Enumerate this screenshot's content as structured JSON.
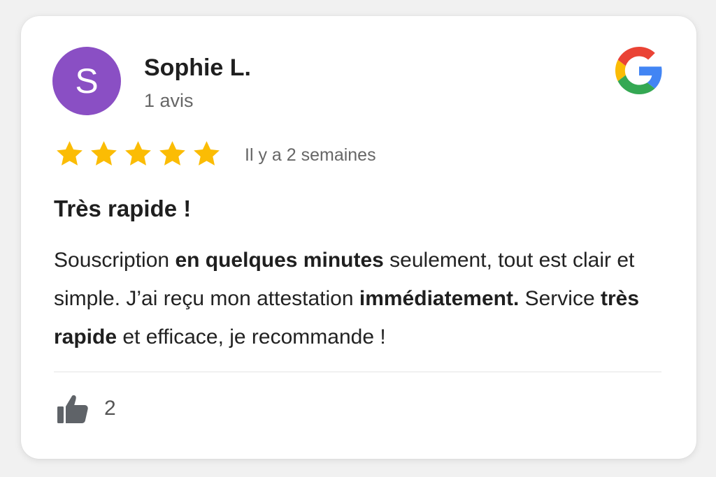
{
  "reviewer": {
    "initial": "S",
    "name": "Sophie L.",
    "review_count": "1 avis",
    "avatar_color": "#8a4fc4"
  },
  "brand": {
    "icon": "google-icon",
    "colors": [
      "#4285F4",
      "#EA4335",
      "#FBBC05",
      "#34A853"
    ]
  },
  "rating": {
    "stars": 5,
    "max": 5,
    "star_color": "#FBBC04",
    "time_ago": "Il y a 2 semaines"
  },
  "review": {
    "title": "Très rapide !",
    "body": [
      {
        "text": "Souscription ",
        "bold": false
      },
      {
        "text": "en quelques minutes",
        "bold": true
      },
      {
        "text": " seulement, tout est clair et simple. J’ai reçu mon attestation ",
        "bold": false
      },
      {
        "text": "immédiatement.",
        "bold": true
      },
      {
        "text": " Service ",
        "bold": false
      },
      {
        "text": "très rapide",
        "bold": true
      },
      {
        "text": " et efficace, je recommande !",
        "bold": false
      }
    ]
  },
  "footer": {
    "like_icon": "thumbs-up-icon",
    "like_count": "2"
  }
}
